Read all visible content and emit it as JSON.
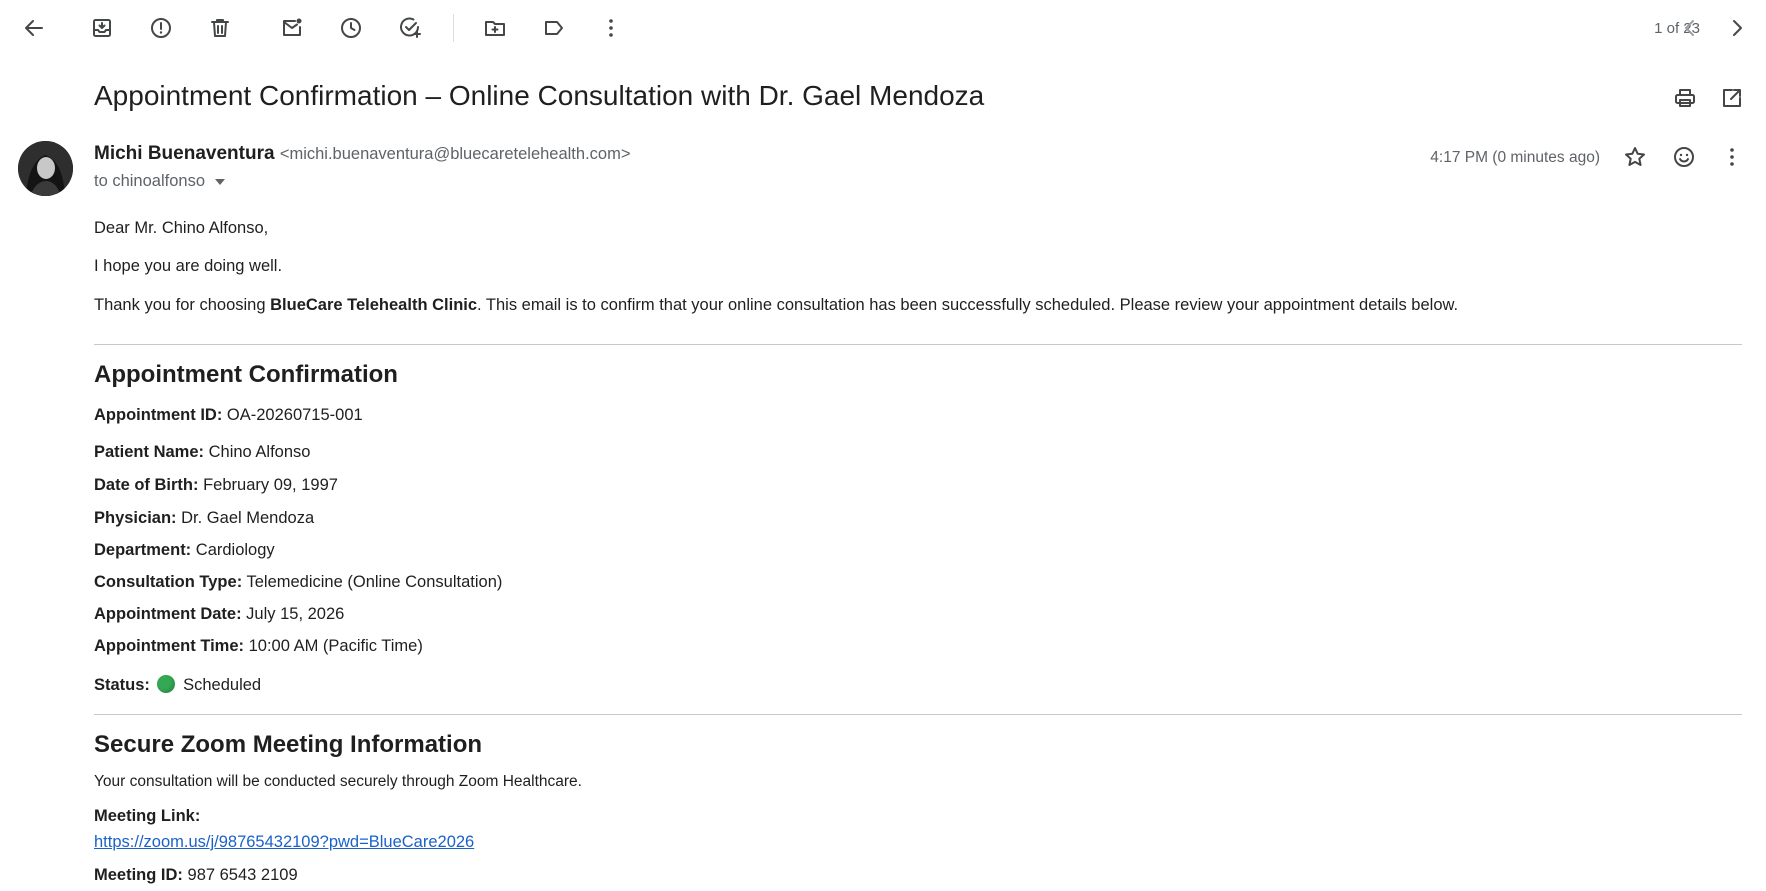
{
  "toolbar": {
    "icons": [
      "back-arrow-icon",
      "archive-icon",
      "report-spam-icon",
      "delete-icon",
      "mark-unread-icon",
      "snooze-icon",
      "add-to-tasks-icon",
      "move-to-icon",
      "label-icon",
      "more-vert-icon"
    ],
    "pager": "1 of 23"
  },
  "email": {
    "subject": "Appointment Confirmation – Online Consultation with Dr. Gael Mendoza",
    "sender_name": "Michi Buenaventura",
    "sender_email": "<michi.buenaventura@bluecaretelehealth.com>",
    "to": "to chinoalfonso",
    "time": "4:17 PM (0 minutes ago)"
  },
  "body": {
    "greeting": "Dear Mr. Chino Alfonso,",
    "line1": "I hope you are doing well.",
    "line2_pre": "Thank you for choosing ",
    "line2_bold": "BlueCare Telehealth Clinic",
    "line2_post": ". This email is to confirm that your online consultation has been successfully scheduled. Please review your appointment details below.",
    "section1_title": "Appointment Confirmation",
    "details": [
      {
        "label": "Appointment ID:",
        "value": "OA-20260715-001"
      },
      {
        "label": "Patient Name:",
        "value": "Chino Alfonso"
      },
      {
        "label": "Date of Birth:",
        "value": "February 09, 1997"
      },
      {
        "label": "Physician:",
        "value": "Dr. Gael Mendoza"
      },
      {
        "label": "Department:",
        "value": "Cardiology"
      },
      {
        "label": "Consultation Type:",
        "value": "Telemedicine (Online Consultation)"
      },
      {
        "label": "Appointment Date:",
        "value": "July 15, 2026"
      },
      {
        "label": "Appointment Time:",
        "value": "10:00 AM (Pacific Time)"
      }
    ],
    "status_label": "Status:",
    "status_value": "Scheduled",
    "status_color": "#34a853",
    "section2_title": "Secure Zoom Meeting Information",
    "zoom_intro": "Your consultation will be conducted securely through Zoom Healthcare.",
    "meeting_link_label": "Meeting Link:",
    "meeting_link": "https://zoom.us/j/98765432109?pwd=BlueCare2026",
    "meeting_id_label": "Meeting ID:",
    "meeting_id": "987 6543 2109"
  }
}
